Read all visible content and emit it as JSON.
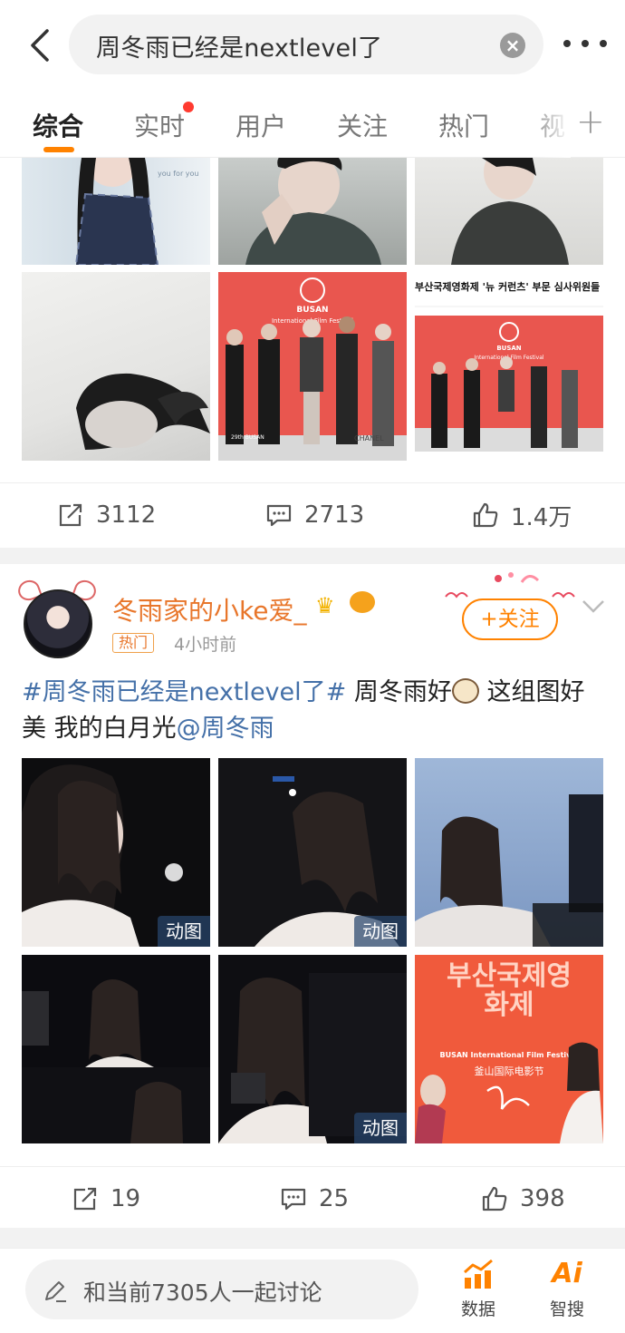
{
  "search": {
    "query": "周冬雨已经是nextlevel了"
  },
  "tabs": [
    {
      "label": "综合",
      "active": true
    },
    {
      "label": "实时",
      "has_dot": true
    },
    {
      "label": "用户"
    },
    {
      "label": "关注"
    },
    {
      "label": "热门"
    },
    {
      "label": "视"
    }
  ],
  "post1": {
    "images": [
      {
        "desc": "photo-top-1"
      },
      {
        "desc": "photo-top-2"
      },
      {
        "desc": "photo-top-3"
      },
      {
        "desc": "photo-bw-portrait"
      },
      {
        "desc": "festival-group-photo",
        "sign_text": "BUSAN International Film Festival"
      },
      {
        "desc": "news-article-screenshot",
        "headline": "부산국제영화제 '뉴 커런츠' 부문 심사위원들",
        "sign_text": "BUSAN International Film Festival"
      }
    ],
    "actions": {
      "repost": "3112",
      "comment": "2713",
      "like": "1.4万"
    }
  },
  "post2": {
    "user": {
      "name": "冬雨家的小ke爱_",
      "tag": "热门",
      "time": "4小时前"
    },
    "follow_label": "+关注",
    "text": {
      "topic": "#周冬雨已经是nextlevel了#",
      "body_1": " 周冬雨好",
      "body_2": " 这组图好美 我的白月光",
      "mention": "@周冬雨"
    },
    "images": [
      {
        "desc": "gif-1",
        "badge": "动图"
      },
      {
        "desc": "gif-2",
        "badge": "动图"
      },
      {
        "desc": "photo-3"
      },
      {
        "desc": "photo-4"
      },
      {
        "desc": "gif-5",
        "badge": "动图"
      },
      {
        "desc": "festival-poster",
        "poster_title": "부산국제영화제",
        "poster_sub": "BUSAN International Film Festival",
        "poster_cn": "釜山国际电影节"
      }
    ],
    "actions": {
      "repost": "19",
      "comment": "25",
      "like": "398"
    }
  },
  "bottom": {
    "discuss_text": "和当前7305人一起讨论",
    "data_label": "数据",
    "ai_glyph": "Ai",
    "ai_label": "智搜"
  },
  "colors": {
    "accent": "#ff8200",
    "link": "#4470a8",
    "badge_bg": "#28466e"
  }
}
